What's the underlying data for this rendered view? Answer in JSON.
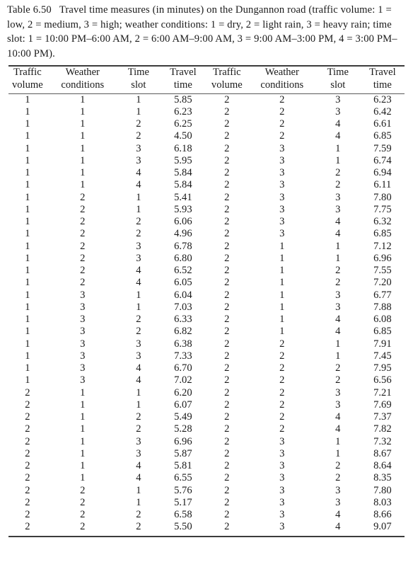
{
  "caption": {
    "label": "Table 6.50",
    "text": "Travel time measures (in minutes) on the Dungannon road (traffic volume: 1 = low, 2 = medium, 3 = high; weather conditions: 1 = dry, 2 = light rain, 3 = heavy rain; time slot: 1 = 10:00 PM–6:00 AM, 2 = 6:00 AM–9:00 AM, 3 = 9:00 AM–3:00 PM, 4 = 3:00 PM–10:00 PM)."
  },
  "headers": {
    "traffic_line1": "Traffic",
    "traffic_line2": "volume",
    "weather_line1": "Weather",
    "weather_line2": "conditions",
    "time_line1": "Time",
    "time_line2": "slot",
    "travel_line1": "Travel",
    "travel_line2": "time"
  },
  "chart_data": {
    "type": "table",
    "title": "Travel time measures (in minutes) on the Dungannon road",
    "columns": [
      "Traffic volume",
      "Weather conditions",
      "Time slot",
      "Travel time",
      "Traffic volume",
      "Weather conditions",
      "Time slot",
      "Travel time"
    ],
    "rows": [
      [
        "1",
        "1",
        "1",
        "5.85",
        "2",
        "2",
        "3",
        "6.23"
      ],
      [
        "1",
        "1",
        "1",
        "6.23",
        "2",
        "2",
        "3",
        "6.42"
      ],
      [
        "1",
        "1",
        "2",
        "6.25",
        "2",
        "2",
        "4",
        "6.61"
      ],
      [
        "1",
        "1",
        "2",
        "4.50",
        "2",
        "2",
        "4",
        "6.85"
      ],
      [
        "1",
        "1",
        "3",
        "6.18",
        "2",
        "3",
        "1",
        "7.59"
      ],
      [
        "1",
        "1",
        "3",
        "5.95",
        "2",
        "3",
        "1",
        "6.74"
      ],
      [
        "1",
        "1",
        "4",
        "5.84",
        "2",
        "3",
        "2",
        "6.94"
      ],
      [
        "1",
        "1",
        "4",
        "5.84",
        "2",
        "3",
        "2",
        "6.11"
      ],
      [
        "1",
        "2",
        "1",
        "5.41",
        "2",
        "3",
        "3",
        "7.80"
      ],
      [
        "1",
        "2",
        "1",
        "5.93",
        "2",
        "3",
        "3",
        "7.75"
      ],
      [
        "1",
        "2",
        "2",
        "6.06",
        "2",
        "3",
        "4",
        "6.32"
      ],
      [
        "1",
        "2",
        "2",
        "4.96",
        "2",
        "3",
        "4",
        "6.85"
      ],
      [
        "1",
        "2",
        "3",
        "6.78",
        "2",
        "1",
        "1",
        "7.12"
      ],
      [
        "1",
        "2",
        "3",
        "6.80",
        "2",
        "1",
        "1",
        "6.96"
      ],
      [
        "1",
        "2",
        "4",
        "6.52",
        "2",
        "1",
        "2",
        "7.55"
      ],
      [
        "1",
        "2",
        "4",
        "6.05",
        "2",
        "1",
        "2",
        "7.20"
      ],
      [
        "1",
        "3",
        "1",
        "6.04",
        "2",
        "1",
        "3",
        "6.77"
      ],
      [
        "1",
        "3",
        "1",
        "7.03",
        "2",
        "1",
        "3",
        "7.88"
      ],
      [
        "1",
        "3",
        "2",
        "6.33",
        "2",
        "1",
        "4",
        "6.08"
      ],
      [
        "1",
        "3",
        "2",
        "6.82",
        "2",
        "1",
        "4",
        "6.85"
      ],
      [
        "1",
        "3",
        "3",
        "6.38",
        "2",
        "2",
        "1",
        "7.91"
      ],
      [
        "1",
        "3",
        "3",
        "7.33",
        "2",
        "2",
        "1",
        "7.45"
      ],
      [
        "1",
        "3",
        "4",
        "6.70",
        "2",
        "2",
        "2",
        "7.95"
      ],
      [
        "1",
        "3",
        "4",
        "7.02",
        "2",
        "2",
        "2",
        "6.56"
      ],
      [
        "2",
        "1",
        "1",
        "6.20",
        "2",
        "2",
        "3",
        "7.21"
      ],
      [
        "2",
        "1",
        "1",
        "6.07",
        "2",
        "2",
        "3",
        "7.69"
      ],
      [
        "2",
        "1",
        "2",
        "5.49",
        "2",
        "2",
        "4",
        "7.37"
      ],
      [
        "2",
        "1",
        "2",
        "5.28",
        "2",
        "2",
        "4",
        "7.82"
      ],
      [
        "2",
        "1",
        "3",
        "6.96",
        "2",
        "3",
        "1",
        "7.32"
      ],
      [
        "2",
        "1",
        "3",
        "5.87",
        "2",
        "3",
        "1",
        "8.67"
      ],
      [
        "2",
        "1",
        "4",
        "5.81",
        "2",
        "3",
        "2",
        "8.64"
      ],
      [
        "2",
        "1",
        "4",
        "6.55",
        "2",
        "3",
        "2",
        "8.35"
      ],
      [
        "2",
        "2",
        "1",
        "5.76",
        "2",
        "3",
        "3",
        "7.80"
      ],
      [
        "2",
        "2",
        "1",
        "5.17",
        "2",
        "3",
        "3",
        "8.03"
      ],
      [
        "2",
        "2",
        "2",
        "6.58",
        "2",
        "3",
        "4",
        "8.66"
      ],
      [
        "2",
        "2",
        "2",
        "5.50",
        "2",
        "3",
        "4",
        "9.07"
      ]
    ]
  }
}
